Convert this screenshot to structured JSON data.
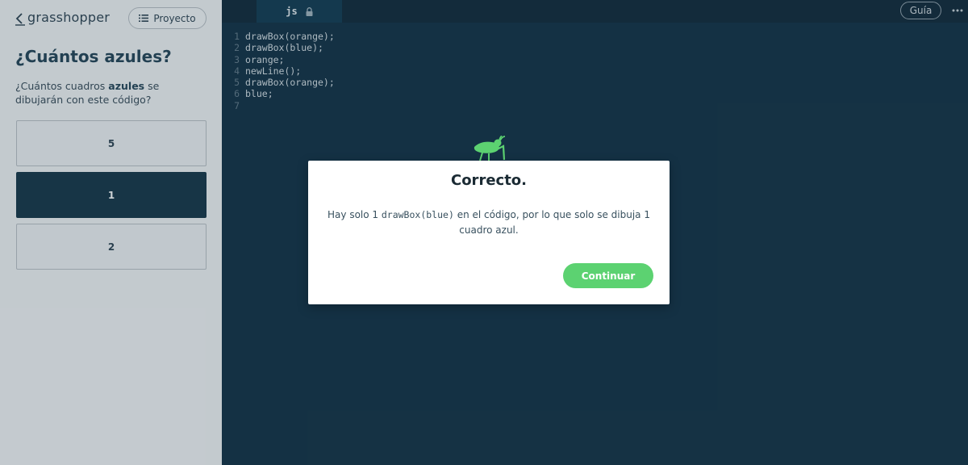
{
  "header": {
    "logo_text": "grasshopper",
    "project_label": "Proyecto"
  },
  "question": {
    "title": "¿Cuántos azules?",
    "prompt_before": "¿Cuántos cuadros ",
    "prompt_bold": "azules",
    "prompt_after": " se dibujarán con este código?"
  },
  "options": [
    {
      "label": "5",
      "selected": false
    },
    {
      "label": "1",
      "selected": true
    },
    {
      "label": "2",
      "selected": false
    }
  ],
  "editor": {
    "tab_label": "js",
    "guide_label": "Guía",
    "lines": [
      {
        "num": "1",
        "text": "drawBox(orange);"
      },
      {
        "num": "2",
        "text": "drawBox(blue);"
      },
      {
        "num": "3",
        "text": "orange;"
      },
      {
        "num": "4",
        "text": "newLine();"
      },
      {
        "num": "5",
        "text": "drawBox(orange);"
      },
      {
        "num": "6",
        "text": "blue;"
      },
      {
        "num": "7",
        "text": ""
      }
    ]
  },
  "modal": {
    "title": "Correcto.",
    "body_before": "Hay solo 1 ",
    "body_code": "drawBox(blue)",
    "body_after": " en el código, por lo que solo se dibuja 1 cuadro azul.",
    "continue_label": "Continuar"
  },
  "colors": {
    "editor_bg": "#022236",
    "selected_option": "#06283a",
    "accent_green": "#5cd271"
  }
}
